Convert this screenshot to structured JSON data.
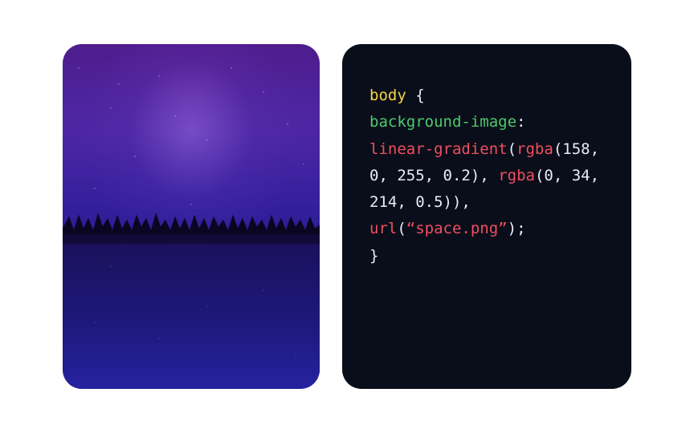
{
  "code": {
    "selector": "body",
    "open_brace": " {",
    "property": "background-image",
    "colon": ":",
    "func1": "linear-gradient",
    "p_open1": "(",
    "func2": "rgba",
    "args1": "(158, 0, 255, 0.2)",
    "comma1": ",",
    "func3": "rgba",
    "args2": "(0, 34, 214, 0.5)",
    "p_close1": ")",
    "comma2": ",",
    "func4": "url",
    "p_open2": "(",
    "string": "“space.png”",
    "p_close2": ")",
    "semi": ";",
    "close_brace": "}"
  }
}
